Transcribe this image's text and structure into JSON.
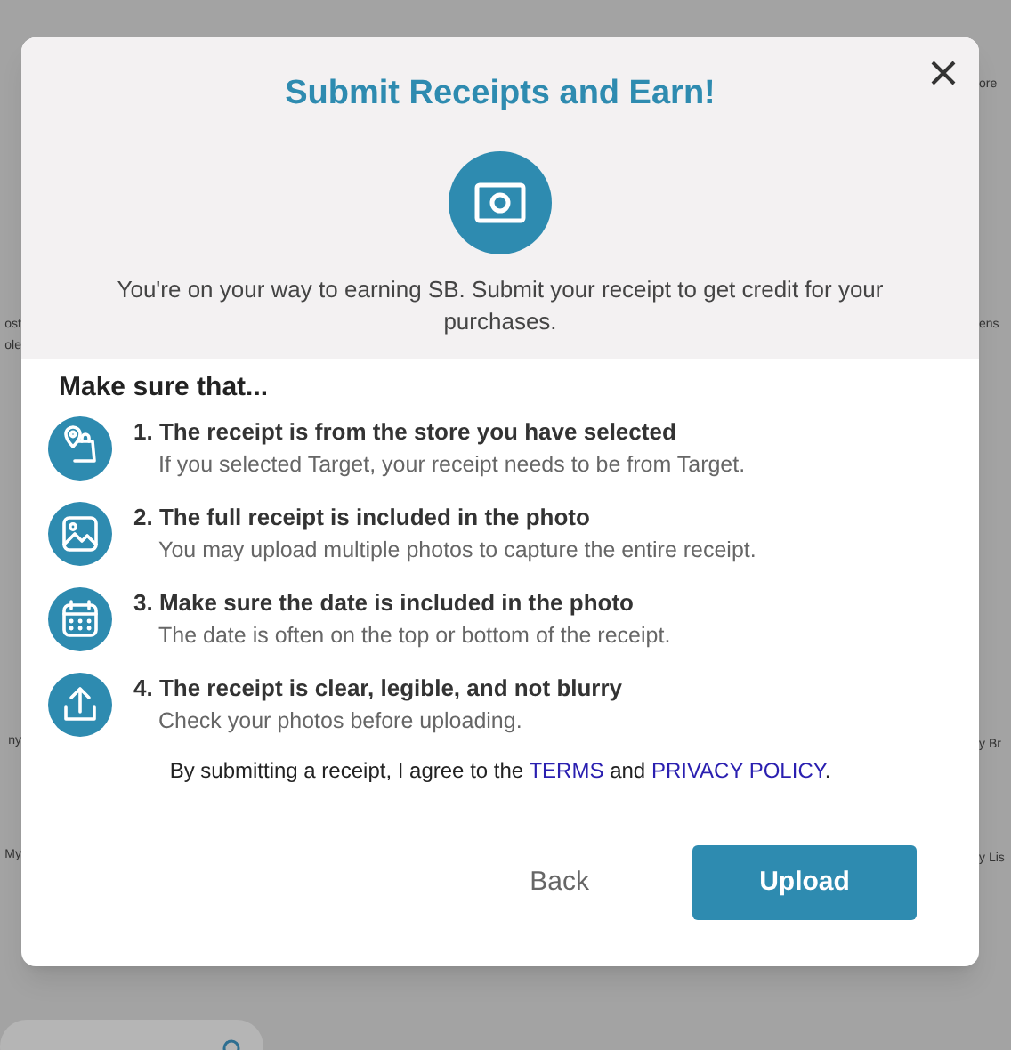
{
  "background": {
    "left_fragments": [
      {
        "text": "ost"
      },
      {
        "text": "ole"
      },
      {
        "text": "ny"
      },
      {
        "text": "My"
      }
    ],
    "right_fragments": [
      {
        "text": "ore"
      },
      {
        "text": "ens"
      },
      {
        "text": "y Br"
      },
      {
        "text": "y Lis"
      }
    ]
  },
  "dialog": {
    "title": "Submit Receipts and Earn!",
    "description": "You're on your way to earning SB. Submit your receipt to get credit for your purchases.",
    "checklist_heading": "Make sure that...",
    "items": [
      {
        "title": "1. The receipt is from the store you have selected",
        "detail": "If you selected Target, your receipt needs to be from Target."
      },
      {
        "title": "2. The full receipt is included in the photo",
        "detail": "You may upload multiple photos to capture the entire receipt."
      },
      {
        "title": "3. Make sure the date is included in the photo",
        "detail": "The date is often on the top or bottom of the receipt."
      },
      {
        "title": "4. The receipt is clear, legible, and not blurry",
        "detail": "Check your photos before uploading."
      }
    ],
    "agreement": {
      "before": "By submitting a receipt, I agree to the",
      "terms_link": "TERMS",
      "middle": "and",
      "privacy_link": "PRIVACY POLICY",
      "end": "."
    },
    "buttons": {
      "back": "Back",
      "upload": "Upload"
    }
  }
}
